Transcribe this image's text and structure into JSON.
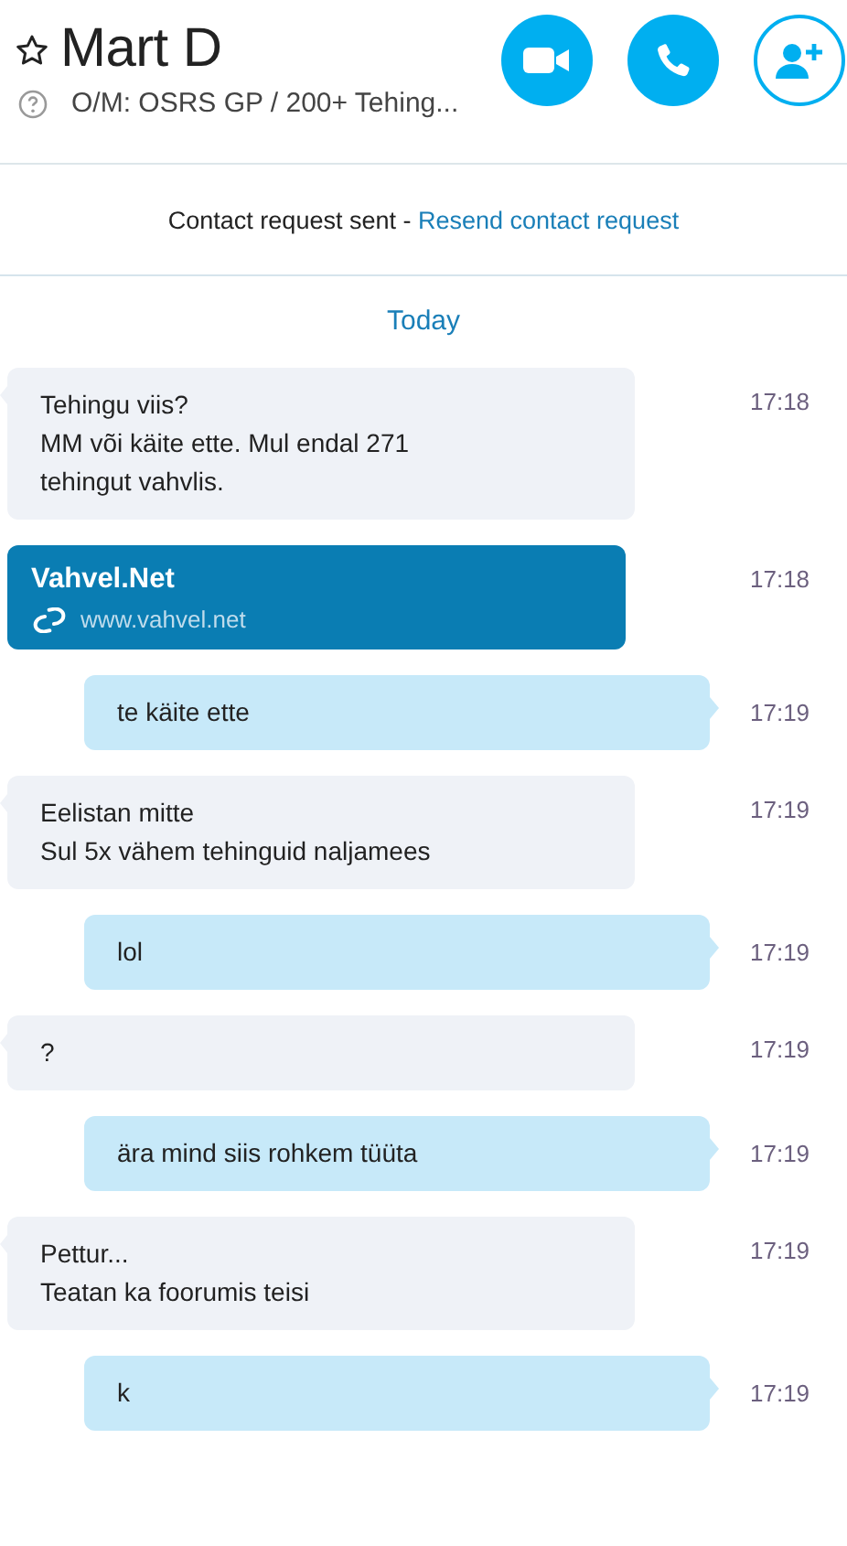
{
  "header": {
    "name": "Mart D",
    "favorite": false,
    "mood": "O/M: OSRS GP / 200+ Tehing...",
    "actions": [
      {
        "kind": "video"
      },
      {
        "kind": "call"
      },
      {
        "kind": "add"
      }
    ]
  },
  "notice": {
    "text": "Contact request sent - ",
    "link": "Resend contact request"
  },
  "date_divider": "Today",
  "messages": [
    {
      "kind": "incoming",
      "lines": [
        "Tehingu viis?",
        "MM või käite ette. Mul endal 271",
        "tehingut vahvlis."
      ],
      "time": "17:18"
    },
    {
      "kind": "link",
      "title": "Vahvel.Net",
      "url": "www.vahvel.net",
      "time": "17:18"
    },
    {
      "kind": "outgoing",
      "lines": [
        "te käite ette"
      ],
      "time": "17:19"
    },
    {
      "kind": "incoming",
      "lines": [
        "Eelistan mitte",
        "Sul 5x vähem tehinguid naljamees"
      ],
      "time": "17:19"
    },
    {
      "kind": "outgoing",
      "lines": [
        "lol"
      ],
      "time": "17:19"
    },
    {
      "kind": "incoming",
      "lines": [
        "?"
      ],
      "time": "17:19"
    },
    {
      "kind": "outgoing",
      "lines": [
        "ära mind siis rohkem tüüta"
      ],
      "time": "17:19"
    },
    {
      "kind": "incoming",
      "lines": [
        "Pettur...",
        "Teatan ka foorumis teisi"
      ],
      "time": "17:19"
    },
    {
      "kind": "outgoing",
      "lines": [
        "k"
      ],
      "time": "17:19"
    }
  ]
}
